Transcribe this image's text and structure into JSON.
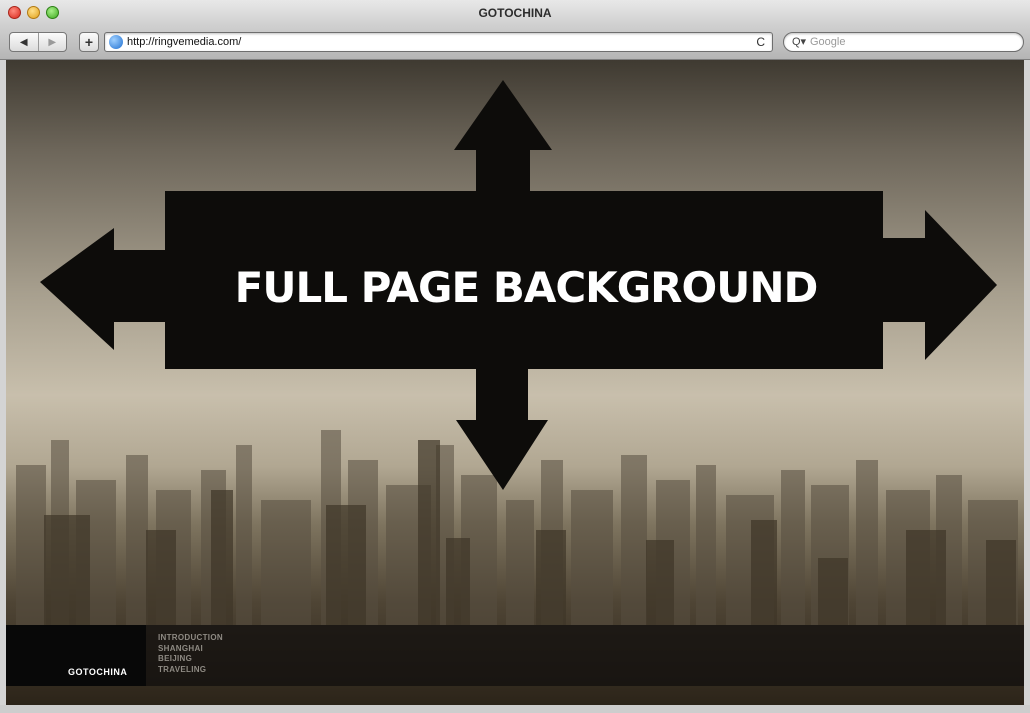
{
  "window": {
    "title": "GOTOCHINA"
  },
  "toolbar": {
    "back_label": "◀",
    "forward_label": "▶",
    "add_label": "+",
    "url": "http://ringvemedia.com/",
    "reload_label": "C",
    "search_placeholder": "Google",
    "search_icon_glyph": "Q▾"
  },
  "page": {
    "headline": "FULL PAGE BACKGROUND",
    "logo": "GOTOCHINA",
    "menu": [
      "INTRODUCTION",
      "SHANGHAI",
      "BEIJING",
      "TRAVELING"
    ]
  },
  "colors": {
    "arrow_fill": "#0d0c0a",
    "footer_bg": "#12100e",
    "menu_text": "#8e8a83"
  }
}
